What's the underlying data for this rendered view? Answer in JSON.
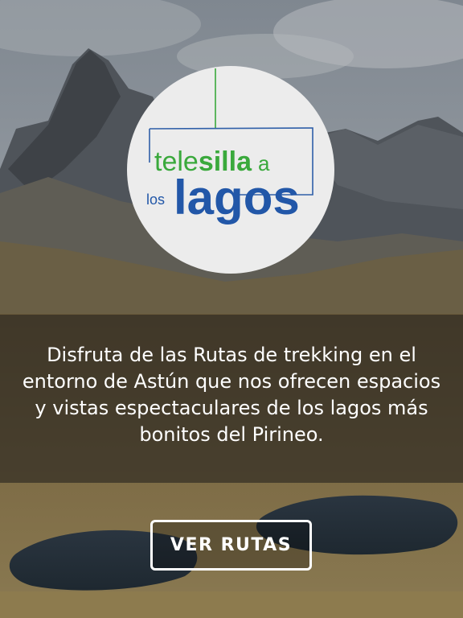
{
  "logo": {
    "line1_part1": "tele",
    "line1_part2": "silla",
    "line1_part3": "a",
    "line2_part1": "los",
    "line2_part2": "lagos",
    "colors": {
      "green": "#3aa93c",
      "blue": "#2257a8",
      "frame": "#2f5fa8"
    }
  },
  "description": "Disfruta de las Rutas de trekking en el entorno de Astún que nos ofrecen espacios y vistas espectaculares de los lagos más bonitos del Pirineo.",
  "cta": {
    "label": "VER RUTAS"
  }
}
